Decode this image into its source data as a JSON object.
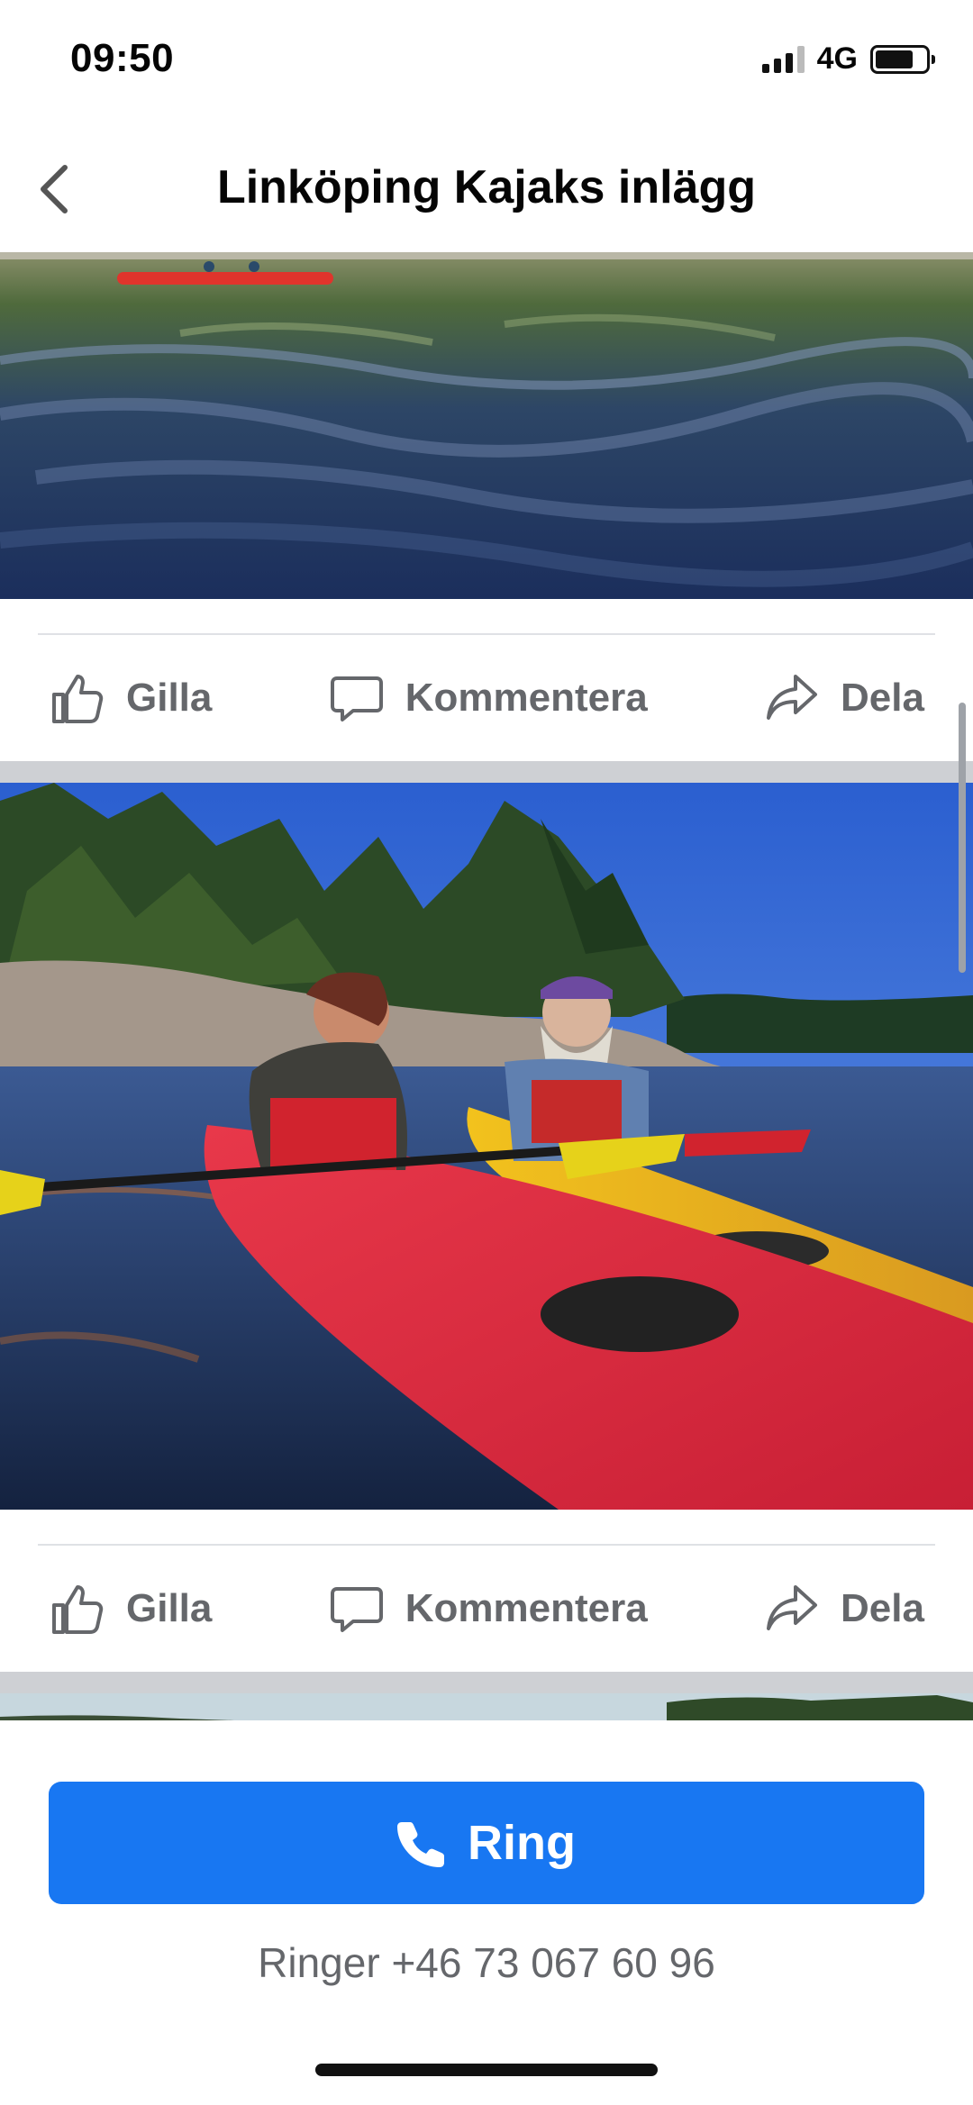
{
  "status_bar": {
    "time": "09:50",
    "network": "4G",
    "battery_level": 0.75
  },
  "header": {
    "title": "Linköping Kajaks inlägg",
    "back_icon": "chevron-left-icon"
  },
  "posts": [
    {
      "actions": [
        {
          "label": "Gilla",
          "icon": "thumbs-up-icon"
        },
        {
          "label": "Kommentera",
          "icon": "comment-icon"
        },
        {
          "label": "Dela",
          "icon": "share-icon"
        }
      ]
    },
    {
      "actions": [
        {
          "label": "Gilla",
          "icon": "thumbs-up-icon"
        },
        {
          "label": "Kommentera",
          "icon": "comment-icon"
        },
        {
          "label": "Dela",
          "icon": "share-icon"
        }
      ]
    }
  ],
  "call_bar": {
    "button_label": "Ring",
    "button_icon": "phone-icon",
    "subtitle": "Ringer +46 73 067 60 96"
  },
  "colors": {
    "accent": "#1877f2",
    "action_text": "#65676b",
    "separator": "#ced0d4"
  }
}
